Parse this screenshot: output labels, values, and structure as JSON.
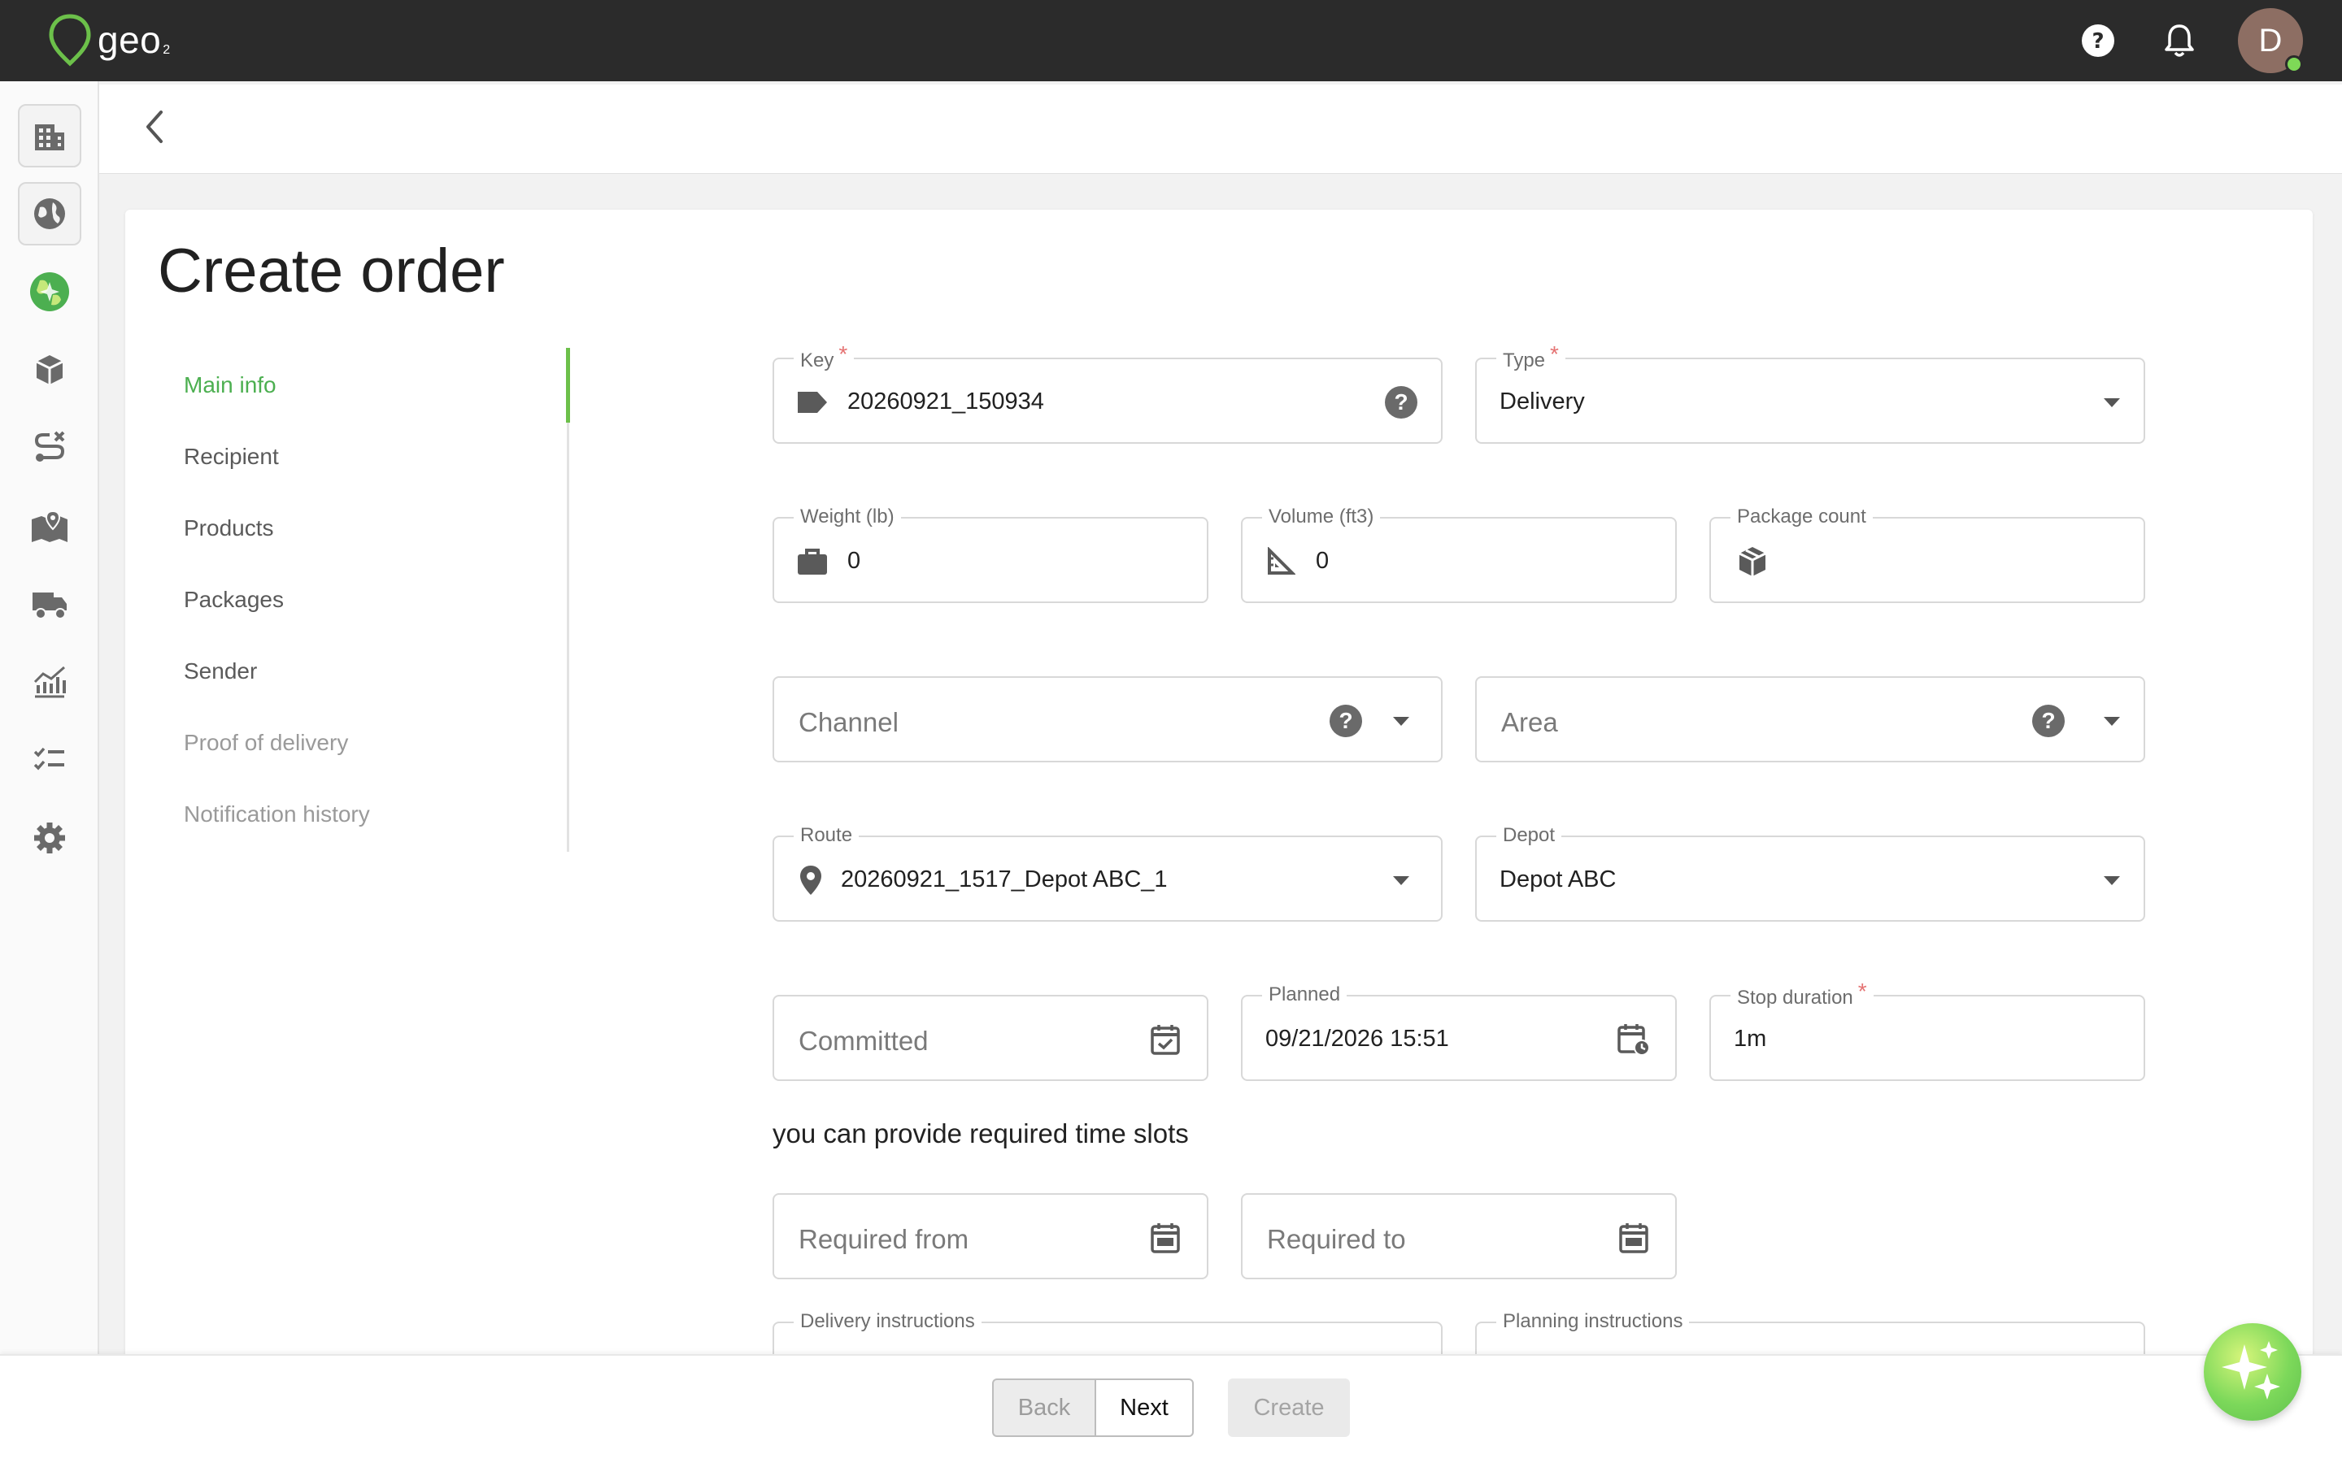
{
  "app": {
    "logo_text": "geo",
    "logo_sub": "2",
    "avatar_initial": "D"
  },
  "page": {
    "title": "Create order"
  },
  "side_nav": {
    "items": [
      {
        "label": "Main info"
      },
      {
        "label": "Recipient"
      },
      {
        "label": "Products"
      },
      {
        "label": "Packages"
      },
      {
        "label": "Sender"
      },
      {
        "label": "Proof of delivery"
      },
      {
        "label": "Notification history"
      }
    ]
  },
  "form": {
    "key": {
      "label": "Key",
      "value": "20260921_150934"
    },
    "type": {
      "label": "Type",
      "value": "Delivery"
    },
    "weight": {
      "label": "Weight (lb)",
      "value": "0"
    },
    "volume": {
      "label": "Volume (ft3)",
      "value": "0"
    },
    "package_count": {
      "label": "Package count",
      "value": ""
    },
    "channel": {
      "placeholder": "Channel"
    },
    "area": {
      "placeholder": "Area"
    },
    "route": {
      "label": "Route",
      "value": "20260921_1517_Depot ABC_1"
    },
    "depot": {
      "label": "Depot",
      "value": "Depot ABC"
    },
    "committed": {
      "placeholder": "Committed"
    },
    "planned": {
      "label": "Planned",
      "value": "09/21/2026 15:51"
    },
    "stop_duration": {
      "label": "Stop duration",
      "value": "1m"
    },
    "time_slots_hint": "you can provide required time slots",
    "required_from": {
      "placeholder": "Required from"
    },
    "required_to": {
      "placeholder": "Required to"
    },
    "delivery_instructions": {
      "label": "Delivery instructions"
    },
    "planning_instructions": {
      "label": "Planning instructions"
    },
    "required_mark": "*"
  },
  "footer": {
    "back_label": "Back",
    "next_label": "Next",
    "create_label": "Create"
  },
  "colors": {
    "accent": "#4caf50",
    "topbar": "#2b2b2b",
    "required": "#e57373"
  },
  "icons": {
    "rail": [
      "building-icon",
      "globe-icon",
      "earth-color-icon",
      "cube-icon",
      "route-icon",
      "map-icon",
      "truck-icon",
      "analytics-icon",
      "checklist-icon",
      "gear-icon"
    ]
  }
}
